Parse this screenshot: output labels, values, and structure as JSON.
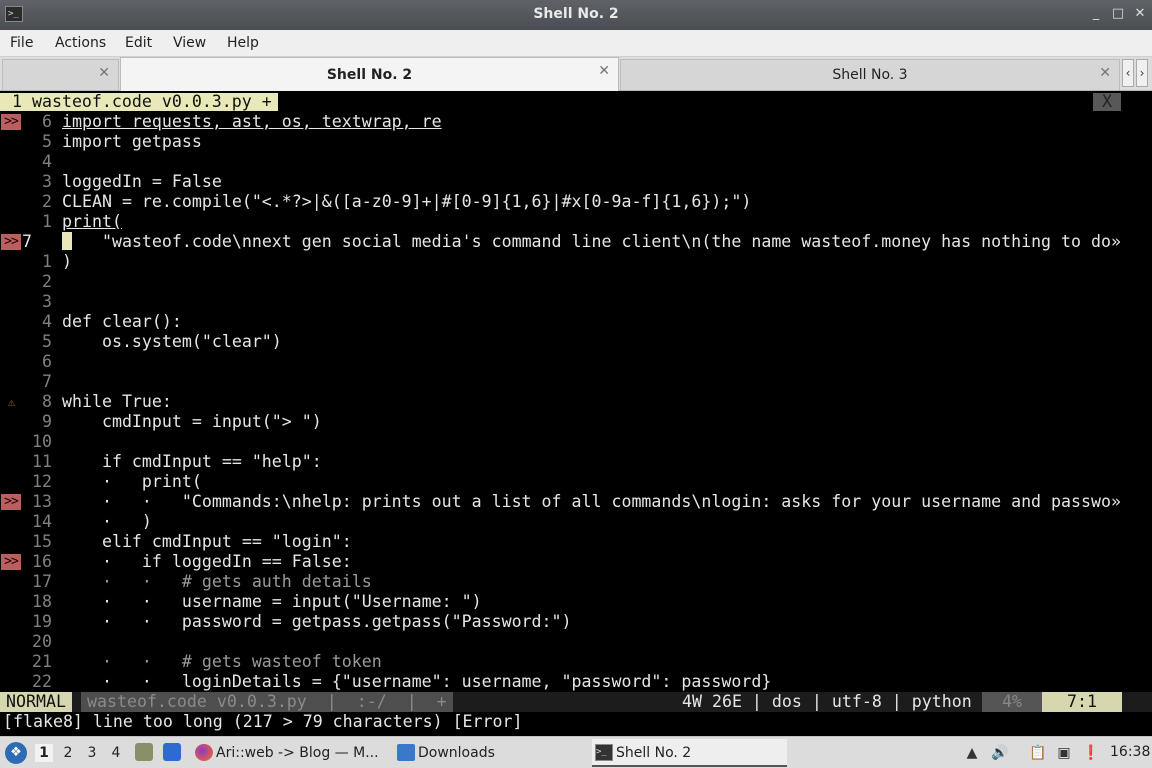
{
  "window": {
    "title": "Shell No. 2",
    "icons": [
      "terminal-icon",
      "minimize-icon",
      "maximize-icon",
      "close-icon"
    ],
    "controls": {
      "minimize": "_",
      "maximize": "□",
      "close": "✕"
    }
  },
  "menu": [
    "File",
    "Actions",
    "Edit",
    "View",
    "Help"
  ],
  "tabs": [
    {
      "label": "",
      "close": "✕"
    },
    {
      "label": "Shell No. 2",
      "close": "✕",
      "active": true
    },
    {
      "label": "Shell No. 3",
      "close": "✕"
    }
  ],
  "tab_scroll": {
    "left": "‹",
    "right": "›"
  },
  "vim": {
    "tabline": "1 wasteof.code v0.0.3.py +",
    "tabline_close": "X",
    "lines": [
      {
        "sign": ">>",
        "num": "6",
        "text": "import requests, ast, os, textwrap, re"
      },
      {
        "sign": "",
        "num": "5",
        "text": "import getpass"
      },
      {
        "sign": "",
        "num": "4",
        "text": ""
      },
      {
        "sign": "",
        "num": "3",
        "text": "loggedIn = False"
      },
      {
        "sign": "",
        "num": "2",
        "text": "CLEAN = re.compile(\"<.*?>|&([a-z0-9]+|#[0-9]{1,6}|#x[0-9a-f]{1,6});\")"
      },
      {
        "sign": "",
        "num": "1",
        "text": "print("
      },
      {
        "sign": ">>",
        "num": "7",
        "text": "    \"wasteof.code\\nnext gen social media's command line client\\n(the name wasteof.money has nothing to do»"
      },
      {
        "sign": "",
        "num": "1",
        "text": ")"
      },
      {
        "sign": "",
        "num": "2",
        "text": ""
      },
      {
        "sign": "",
        "num": "3",
        "text": ""
      },
      {
        "sign": "",
        "num": "4",
        "text": "def clear():"
      },
      {
        "sign": "",
        "num": "5",
        "text": "    os.system(\"clear\")"
      },
      {
        "sign": "",
        "num": "6",
        "text": ""
      },
      {
        "sign": "",
        "num": "7",
        "text": ""
      },
      {
        "sign": "⚠",
        "num": "8",
        "text": "while True:"
      },
      {
        "sign": "",
        "num": "9",
        "text": "    cmdInput = input(\"> \")"
      },
      {
        "sign": "",
        "num": "10",
        "text": ""
      },
      {
        "sign": "",
        "num": "11",
        "text": "    if cmdInput == \"help\":"
      },
      {
        "sign": "",
        "num": "12",
        "text": "    ·   print("
      },
      {
        "sign": ">>",
        "num": "13",
        "text": "    ·   ·   \"Commands:\\nhelp: prints out a list of all commands\\nlogin: asks for your username and passwo»"
      },
      {
        "sign": "",
        "num": "14",
        "text": "    ·   )"
      },
      {
        "sign": "",
        "num": "15",
        "text": "    elif cmdInput == \"login\":"
      },
      {
        "sign": ">>",
        "num": "16",
        "text": "    ·   if loggedIn == False:"
      },
      {
        "sign": "",
        "num": "17",
        "text": "    ·   ·   # gets auth details"
      },
      {
        "sign": "",
        "num": "18",
        "text": "    ·   ·   username = input(\"Username: \")"
      },
      {
        "sign": "",
        "num": "19",
        "text": "    ·   ·   password = getpass.getpass(\"Password:\")"
      },
      {
        "sign": "",
        "num": "20",
        "text": ""
      },
      {
        "sign": "",
        "num": "21",
        "text": "    ·   ·   # gets wasteof token"
      },
      {
        "sign": "",
        "num": "22",
        "text": "    ·   ·   loginDetails = {\"username\": username, \"password\": password}"
      }
    ],
    "status": {
      "mode": "NORMAL",
      "file": "wasteof.code v0.0.3.py  |  :-/  |  +",
      "info": "4W 26E | dos | utf-8 | python",
      "percent": "4%",
      "position": "7:1"
    },
    "message": "[flake8] line too long (217 > 79 characters) [Error]"
  },
  "taskbar": {
    "start_icon": "menu-icon",
    "workspaces": [
      "1",
      "2",
      "3",
      "4"
    ],
    "quick_icons": [
      "file-manager-icon",
      "desktop-icon"
    ],
    "tasks": [
      {
        "label": "Ari::web -> Blog — M...",
        "icon": "firefox-icon"
      },
      {
        "label": "Downloads",
        "icon": "folder-icon"
      },
      {
        "label": "Shell No. 2",
        "icon": "terminal-icon",
        "active": true
      }
    ],
    "tray_icons": [
      "updates-icon",
      "volume-icon",
      "clipboard-icon",
      "network-icon",
      "notification-icon"
    ],
    "clock": "16:38"
  }
}
